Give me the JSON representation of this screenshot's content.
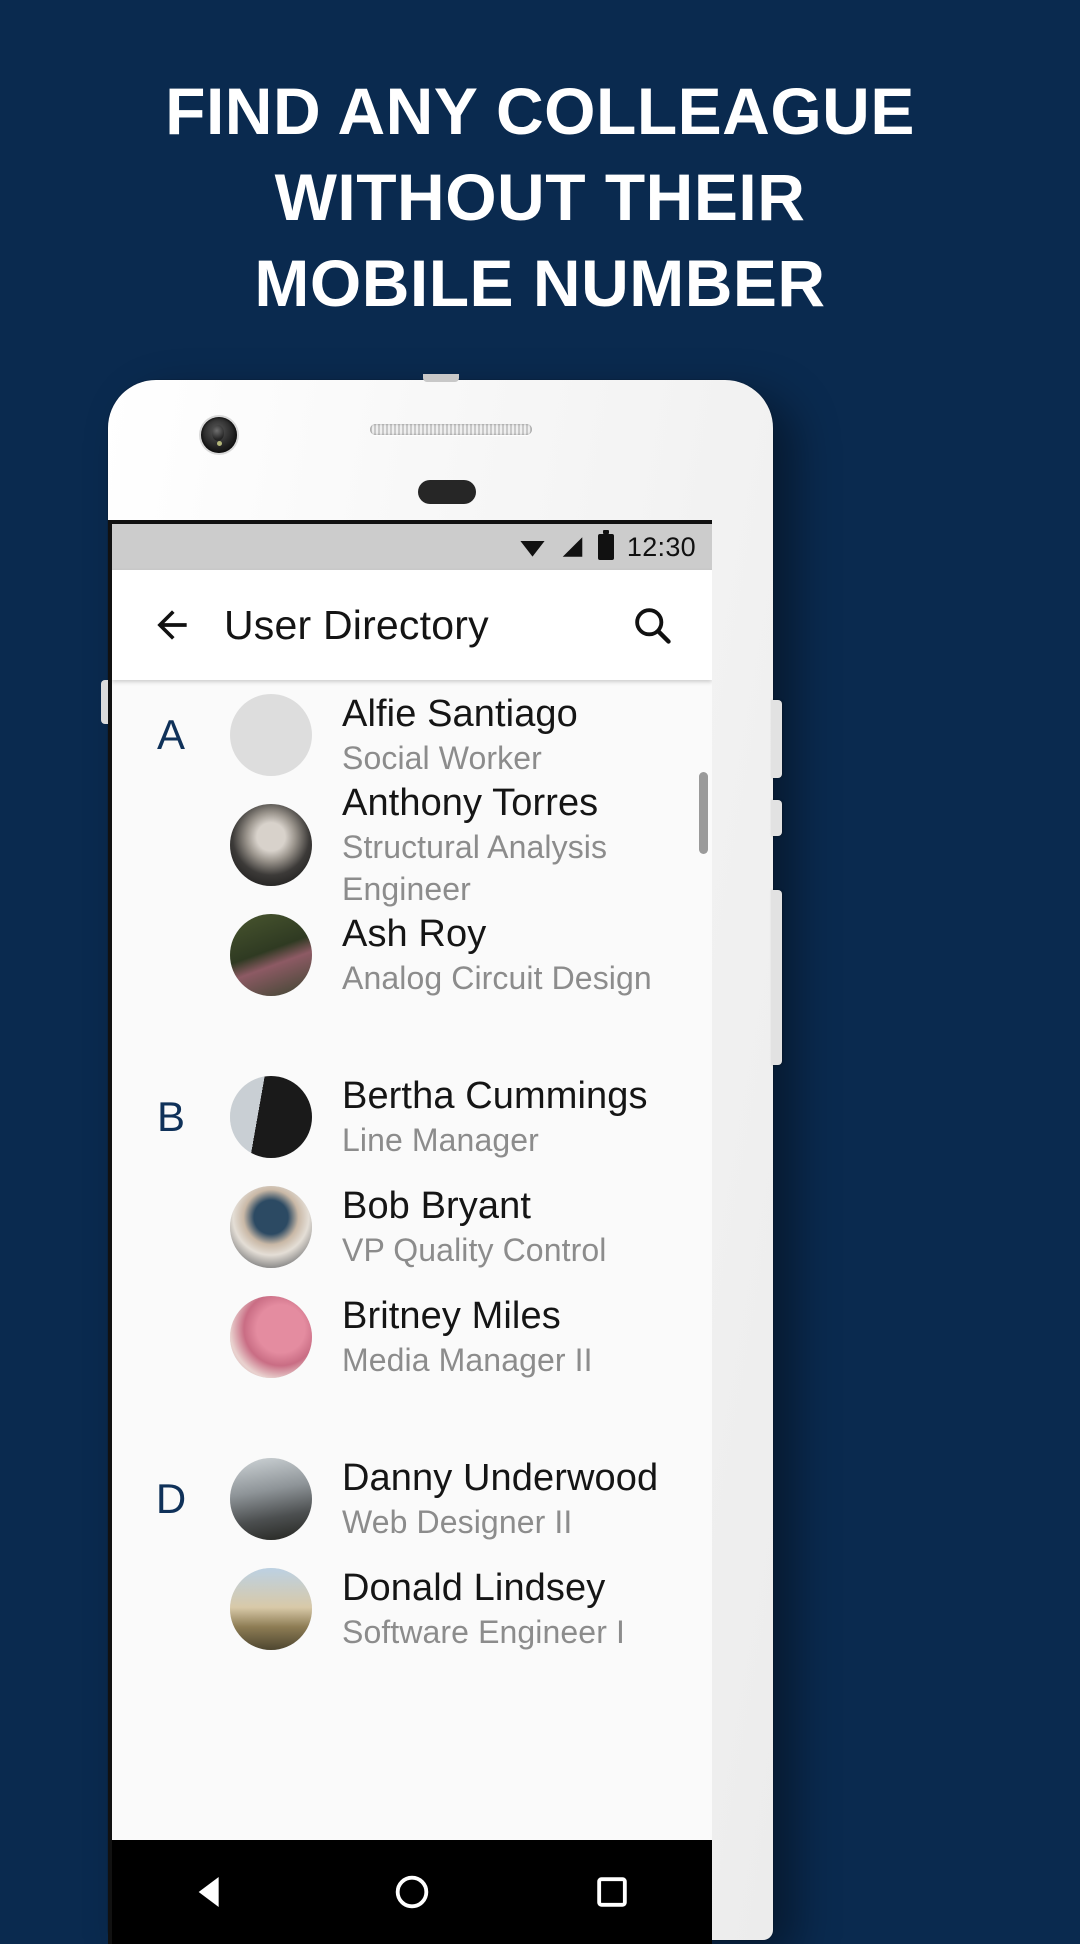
{
  "promo": {
    "background_color": "#0a2a4f",
    "headline_lines": [
      "FIND ANY COLLEAGUE",
      "WITHOUT THEIR",
      "MOBILE NUMBER"
    ],
    "headline_color": "#ffffff"
  },
  "phone": {
    "statusbar": {
      "time": "12:30",
      "icons": [
        "wifi-icon",
        "cellular-signal-icon",
        "battery-icon"
      ],
      "background_color": "#cccccc"
    },
    "appbar": {
      "back_label": "back-arrow-icon",
      "title": "User Directory",
      "search_label": "search-icon",
      "background_color": "#ffffff",
      "title_color": "#141414"
    },
    "navbar": {
      "back_label": "nav-back-triangle-icon",
      "home_label": "nav-home-circle-icon",
      "recents_label": "nav-recents-square-icon"
    },
    "section_letter_color": "#0f3159",
    "list": [
      {
        "letter": "A",
        "people": [
          {
            "name": "Alfie Santiago",
            "role": "Social Worker",
            "avatar": "a-forest"
          },
          {
            "name": "Anthony Torres",
            "role": "Structural Analysis Engineer",
            "avatar": "a-man1"
          },
          {
            "name": "Ash Roy",
            "role": "Analog Circuit Design",
            "avatar": "a-flower"
          }
        ]
      },
      {
        "letter": "B",
        "people": [
          {
            "name": "Bertha Cummings",
            "role": "Line Manager",
            "avatar": "a-dark"
          },
          {
            "name": "Bob Bryant",
            "role": "VP Quality Control",
            "avatar": "a-bob"
          },
          {
            "name": "Britney Miles",
            "role": "Media Manager II",
            "avatar": "a-pink"
          }
        ]
      },
      {
        "letter": "D",
        "people": [
          {
            "name": "Danny Underwood",
            "role": "Web Designer II",
            "avatar": "a-danny"
          },
          {
            "name": "Donald Lindsey",
            "role": "Software Engineer I",
            "avatar": "a-dunes"
          }
        ]
      }
    ]
  }
}
